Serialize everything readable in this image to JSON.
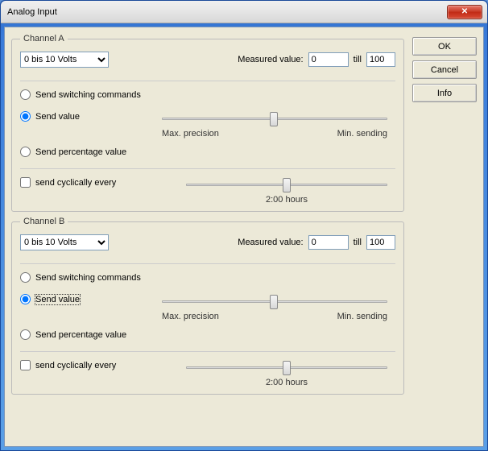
{
  "window": {
    "title": "Analog Input"
  },
  "buttons": {
    "ok": "OK",
    "cancel": "Cancel",
    "info": "Info"
  },
  "labels": {
    "measured_value": "Measured value:",
    "till": "till",
    "send_switching": "Send switching commands",
    "send_value": "Send value",
    "send_percentage": "Send percentage value",
    "send_cyclically": "send cyclically every",
    "max_precision": "Max. precision",
    "min_sending": "Min. sending"
  },
  "channelA": {
    "legend": "Channel A",
    "range_selected": "0 bis 10 Volts",
    "measured_from": "0",
    "measured_to": "100",
    "cyclic_label": "2:00 hours"
  },
  "channelB": {
    "legend": "Channel B",
    "range_selected": "0 bis 10 Volts",
    "measured_from": "0",
    "measured_to": "100",
    "cyclic_label": "2:00 hours"
  }
}
